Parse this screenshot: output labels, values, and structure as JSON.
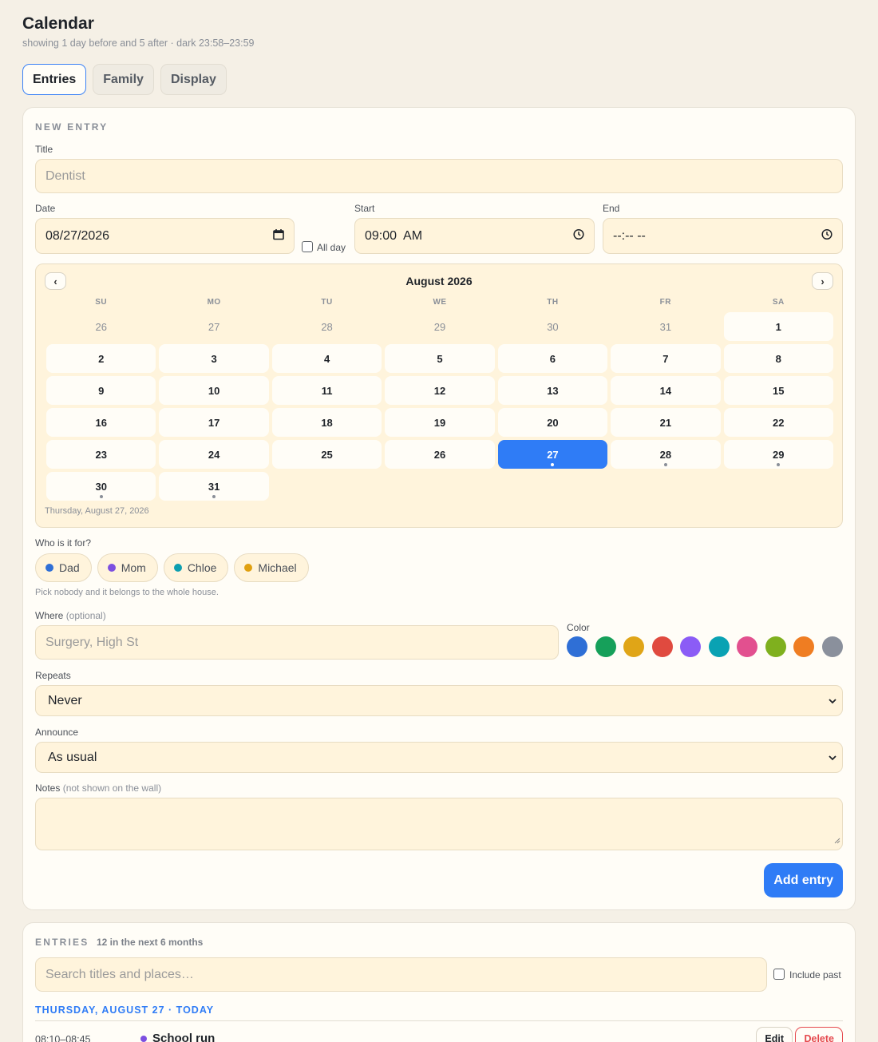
{
  "header": {
    "title": "Calendar",
    "subtitle": "showing 1 day before and 5 after · dark 23:58–23:59"
  },
  "tabs": [
    {
      "label": "Entries",
      "active": true
    },
    {
      "label": "Family",
      "active": false
    },
    {
      "label": "Display",
      "active": false
    }
  ],
  "new_entry": {
    "section_title": "NEW ENTRY",
    "title_label": "Title",
    "title_placeholder": "Dentist",
    "date_label": "Date",
    "date_value": "08/27/2026",
    "all_day_label": "All day",
    "all_day_checked": false,
    "start_label": "Start",
    "start_value": "09:00  AM",
    "end_label": "End",
    "end_value": "--:-- --",
    "calendar": {
      "month_title": "August 2026",
      "prev": "‹",
      "next": "›",
      "weekdays": [
        "SU",
        "MO",
        "TU",
        "WE",
        "TH",
        "FR",
        "SA"
      ],
      "days": [
        {
          "n": "26",
          "muted": true
        },
        {
          "n": "27",
          "muted": true
        },
        {
          "n": "28",
          "muted": true
        },
        {
          "n": "29",
          "muted": true
        },
        {
          "n": "30",
          "muted": true
        },
        {
          "n": "31",
          "muted": true
        },
        {
          "n": "1"
        },
        {
          "n": "2"
        },
        {
          "n": "3"
        },
        {
          "n": "4"
        },
        {
          "n": "5"
        },
        {
          "n": "6"
        },
        {
          "n": "7"
        },
        {
          "n": "8"
        },
        {
          "n": "9"
        },
        {
          "n": "10"
        },
        {
          "n": "11"
        },
        {
          "n": "12"
        },
        {
          "n": "13"
        },
        {
          "n": "14"
        },
        {
          "n": "15"
        },
        {
          "n": "16"
        },
        {
          "n": "17"
        },
        {
          "n": "18"
        },
        {
          "n": "19"
        },
        {
          "n": "20"
        },
        {
          "n": "21"
        },
        {
          "n": "22"
        },
        {
          "n": "23"
        },
        {
          "n": "24"
        },
        {
          "n": "25"
        },
        {
          "n": "26"
        },
        {
          "n": "27",
          "selected": true,
          "dot": true
        },
        {
          "n": "28",
          "dot": true
        },
        {
          "n": "29",
          "dot": true
        },
        {
          "n": "30",
          "dot": true
        },
        {
          "n": "31",
          "dot": true
        }
      ],
      "selected_caption": "Thursday, August 27, 2026"
    },
    "who_label": "Who is it for?",
    "people": [
      {
        "name": "Dad",
        "color": "#2f6fd6"
      },
      {
        "name": "Mom",
        "color": "#7c4fe0"
      },
      {
        "name": "Chloe",
        "color": "#0d9fb0"
      },
      {
        "name": "Michael",
        "color": "#e0a010"
      }
    ],
    "who_hint": "Pick nobody and it belongs to the whole house.",
    "where_label": "Where",
    "where_optional": "(optional)",
    "where_placeholder": "Surgery, High St",
    "color_label": "Color",
    "colors": [
      "#2f6fd6",
      "#16a05a",
      "#e0a517",
      "#e04a3f",
      "#8b5cf6",
      "#0aa2b3",
      "#e2508f",
      "#7fb01e",
      "#ef7d22",
      "#8a909c"
    ],
    "repeats_label": "Repeats",
    "repeats_value": "Never",
    "announce_label": "Announce",
    "announce_value": "As usual",
    "notes_label": "Notes",
    "notes_note": "(not shown on the wall)",
    "notes_value": "",
    "add_button": "Add entry"
  },
  "entries": {
    "section_title": "ENTRIES",
    "count_text": "12 in the next 6 months",
    "search_placeholder": "Search titles and places…",
    "include_past_label": "Include past",
    "day_heading": "THURSDAY, AUGUST 27 · TODAY",
    "items": [
      {
        "time": "08:10–08:45",
        "title": "School run",
        "color": "#7c4fe0",
        "edit": "Edit",
        "delete": "Delete"
      }
    ]
  }
}
